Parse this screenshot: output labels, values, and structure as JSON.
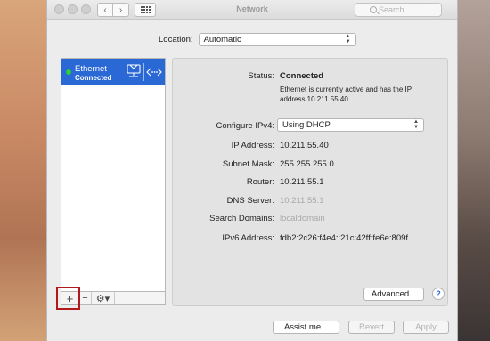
{
  "window": {
    "title": "Network",
    "search_placeholder": "Search"
  },
  "toolbar": {
    "back_glyph": "‹",
    "forward_glyph": "›"
  },
  "location": {
    "label": "Location:",
    "value": "Automatic"
  },
  "services": [
    {
      "name": "Ethernet",
      "status": "Connected",
      "status_color": "#2ccf37",
      "icon": "ethernet-icon"
    }
  ],
  "sidebar_tools": {
    "add": "+",
    "remove": "−",
    "gear": "⚙▾"
  },
  "details": {
    "status_label": "Status:",
    "status_value": "Connected",
    "status_desc": "Ethernet is currently active and has the IP address 10.211.55.40.",
    "configure_label": "Configure IPv4:",
    "configure_value": "Using DHCP",
    "ip_label": "IP Address:",
    "ip_value": "10.211.55.40",
    "subnet_label": "Subnet Mask:",
    "subnet_value": "255.255.255.0",
    "router_label": "Router:",
    "router_value": "10.211.55.1",
    "dns_label": "DNS Server:",
    "dns_value": "10.211.55.1",
    "search_domains_label": "Search Domains:",
    "search_domains_value": "localdomain",
    "ipv6_label": "IPv6 Address:",
    "ipv6_value": "fdb2:2c26:f4e4::21c:42ff:fe6e:809f"
  },
  "buttons": {
    "advanced": "Advanced...",
    "help": "?",
    "assist": "Assist me...",
    "revert": "Revert",
    "apply": "Apply"
  },
  "colors": {
    "accent": "#2a68d6",
    "highlight": "#b11a1a"
  }
}
